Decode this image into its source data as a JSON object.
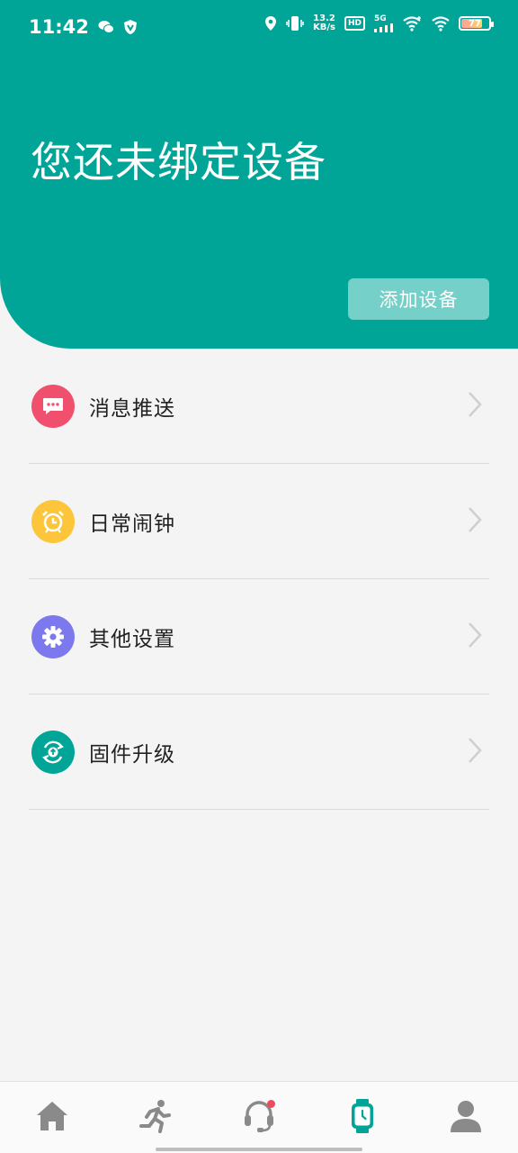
{
  "status_bar": {
    "time": "11:42",
    "net_speed_value": "13.2",
    "net_speed_unit": "KB/s",
    "hd_label": "HD",
    "signal_label": "5G",
    "battery_level": "77"
  },
  "header": {
    "title": "您还未绑定设备",
    "add_device_label": "添加设备"
  },
  "menu": {
    "items": [
      {
        "label": "消息推送",
        "icon": "message-icon",
        "color": "#f0506e"
      },
      {
        "label": "日常闹钟",
        "icon": "alarm-clock-icon",
        "color": "#fcc53a"
      },
      {
        "label": "其他设置",
        "icon": "gear-icon",
        "color": "#7c78ee"
      },
      {
        "label": "固件升级",
        "icon": "firmware-upgrade-icon",
        "color": "#00a598"
      }
    ]
  },
  "bottom_nav": {
    "items": [
      {
        "icon": "home-icon",
        "active": false
      },
      {
        "icon": "running-icon",
        "active": false
      },
      {
        "icon": "headset-icon",
        "active": false,
        "badge": true
      },
      {
        "icon": "watch-icon",
        "active": true
      },
      {
        "icon": "profile-icon",
        "active": false
      }
    ]
  },
  "colors": {
    "brand": "#00a598",
    "button_bg": "#74d0c8",
    "background": "#f4f4f4",
    "inactive_nav": "#8a8a8a"
  }
}
